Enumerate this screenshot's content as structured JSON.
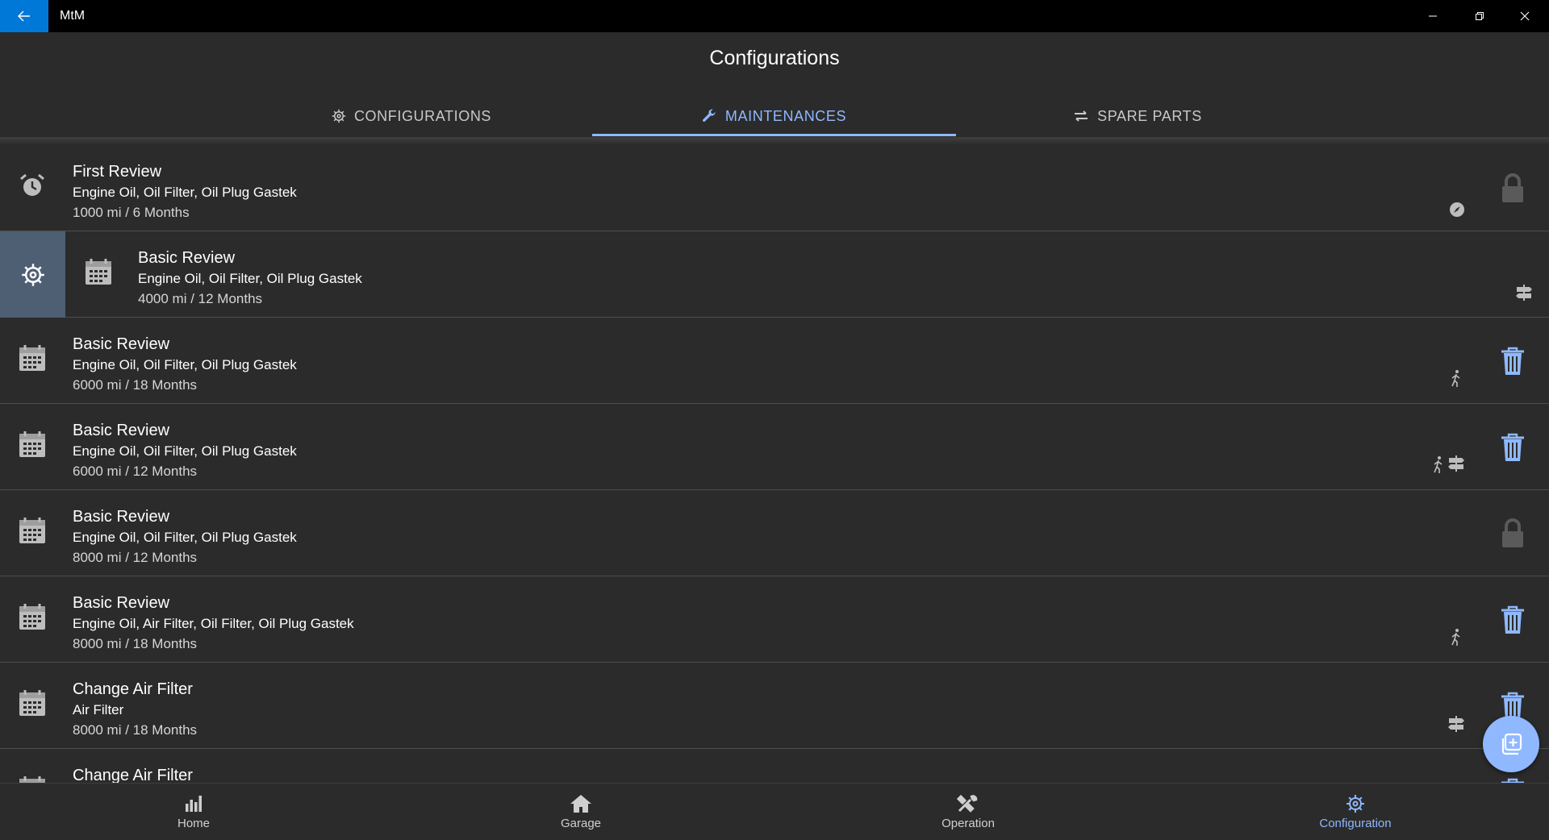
{
  "window": {
    "title": "MtM"
  },
  "page": {
    "title": "Configurations"
  },
  "tabs": [
    {
      "label": "CONFIGURATIONS",
      "icon": "gear-icon",
      "active": false
    },
    {
      "label": "MAINTENANCES",
      "icon": "wrench-icon",
      "active": true
    },
    {
      "label": "SPARE PARTS",
      "icon": "swap-icon",
      "active": false
    }
  ],
  "maintenances": [
    {
      "title": "First Review",
      "parts": "Engine Oil, Oil Filter, Oil Plug Gastek",
      "interval": "1000 mi / 6 Months",
      "icon": "alarm-clock-icon",
      "badges": [
        "compass-icon"
      ],
      "action": "lock-icon"
    },
    {
      "title": "Basic Review",
      "parts": "Engine Oil, Oil Filter, Oil Plug Gastek",
      "interval": "4000 mi / 12 Months",
      "icon": "calendar-icon",
      "badges": [
        "road-sign-icon"
      ],
      "action": "none",
      "swiped": true
    },
    {
      "title": "Basic Review",
      "parts": "Engine Oil, Oil Filter, Oil Plug Gastek",
      "interval": "6000 mi / 18 Months",
      "icon": "calendar-icon",
      "badges": [
        "walker-icon"
      ],
      "action": "trash-icon"
    },
    {
      "title": "Basic Review",
      "parts": "Engine Oil, Oil Filter, Oil Plug Gastek",
      "interval": "6000 mi / 12 Months",
      "icon": "calendar-icon",
      "badges": [
        "walker-icon",
        "road-sign-icon"
      ],
      "action": "trash-icon"
    },
    {
      "title": "Basic Review",
      "parts": "Engine Oil, Oil Filter, Oil Plug Gastek",
      "interval": "8000 mi / 12 Months",
      "icon": "calendar-icon",
      "badges": [],
      "action": "lock-icon"
    },
    {
      "title": "Basic Review",
      "parts": "Engine Oil, Air Filter, Oil Filter, Oil Plug Gastek",
      "interval": "8000 mi / 18 Months",
      "icon": "calendar-icon",
      "badges": [
        "walker-icon"
      ],
      "action": "trash-icon"
    },
    {
      "title": "Change Air Filter",
      "parts": "Air Filter",
      "interval": "8000 mi / 18 Months",
      "icon": "calendar-icon",
      "badges": [
        "road-sign-icon"
      ],
      "action": "trash-icon"
    },
    {
      "title": "Change Air Filter",
      "parts": "",
      "interval": "",
      "icon": "calendar-icon",
      "badges": [],
      "action": "trash-icon"
    }
  ],
  "bottom_nav": [
    {
      "label": "Home",
      "icon": "bar-chart-icon",
      "active": false
    },
    {
      "label": "Garage",
      "icon": "house-icon",
      "active": false
    },
    {
      "label": "Operation",
      "icon": "tools-icon",
      "active": false
    },
    {
      "label": "Configuration",
      "icon": "gear-icon",
      "active": true
    }
  ],
  "colors": {
    "accent": "#8fb8ff",
    "titlebar": "#000000",
    "back_button": "#0078d7",
    "background": "#2b2b2b",
    "swipe_panel": "#4e5f74"
  }
}
